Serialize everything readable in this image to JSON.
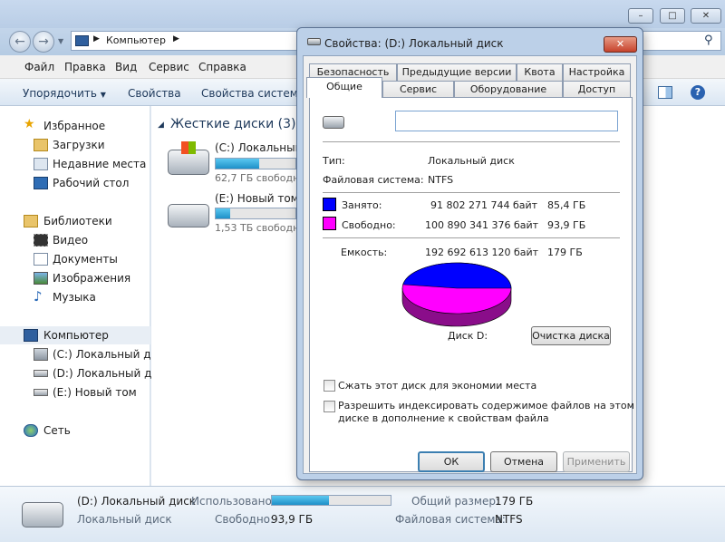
{
  "explorer": {
    "address": {
      "computer_label": "Компьютер"
    },
    "menu": [
      "Файл",
      "Правка",
      "Вид",
      "Сервис",
      "Справка"
    ],
    "commands": {
      "organize": "Упорядочить",
      "properties": "Свойства",
      "system_properties": "Свойства системы"
    },
    "nav": {
      "favorites": "Избранное",
      "downloads": "Загрузки",
      "recent": "Недавние места",
      "desktop": "Рабочий стол",
      "libraries": "Библиотеки",
      "video": "Видео",
      "documents": "Документы",
      "images": "Изображения",
      "music": "Музыка",
      "computer": "Компьютер",
      "drive_c": "(C:) Локальный дис",
      "drive_d": "(D:) Локальный дис",
      "drive_e": "(E:) Новый том",
      "network": "Сеть"
    },
    "content": {
      "group_title": "Жесткие диски (3)",
      "drives": [
        {
          "name": "(C:) Локальный",
          "free": "62,7 ГБ свободно",
          "used_fraction": 0.55
        },
        {
          "name": "(E:) Новый том",
          "free": "1,53 ТБ свободно",
          "used_fraction": 0.18
        }
      ]
    },
    "details": {
      "name": "(D:) Локальный диск",
      "type": "Локальный диск",
      "used_label": "Использовано:",
      "used_fraction": 0.48,
      "free_label": "Свободно:",
      "free_value": "93,9 ГБ",
      "total_label": "Общий размер:",
      "total_value": "179 ГБ",
      "fs_label": "Файловая система:",
      "fs_value": "NTFS"
    }
  },
  "dialog": {
    "title": "Свойства: (D:) Локальный диск",
    "tabs_row1": [
      "Безопасность",
      "Предыдущие версии",
      "Квота",
      "Настройка"
    ],
    "tabs_row2": [
      "Общие",
      "Сервис",
      "Оборудование",
      "Доступ"
    ],
    "active_tab": "Общие",
    "label_value": "",
    "type_label": "Тип:",
    "type_value": "Локальный диск",
    "fs_label": "Файловая система:",
    "fs_value": "NTFS",
    "used_label": "Занято:",
    "used_bytes": "91 802 271 744 байт",
    "used_gb": "85,4 ГБ",
    "free_label": "Свободно:",
    "free_bytes": "100 890 341 376 байт",
    "free_gb": "93,9 ГБ",
    "capacity_label": "Емкость:",
    "capacity_bytes": "192 692 613 120 байт",
    "capacity_gb": "179 ГБ",
    "disk_label": "Диск D:",
    "cleanup_button": "Очистка диска",
    "compress_label": "Сжать этот диск для экономии места",
    "index_label_line1": "Разрешить индексировать содержимое файлов на этом",
    "index_label_line2": "диске в дополнение к свойствам файла",
    "ok": "ОК",
    "cancel": "Отмена",
    "apply": "Применить",
    "colors": {
      "used": "#0000ff",
      "free": "#ff00ff"
    }
  }
}
